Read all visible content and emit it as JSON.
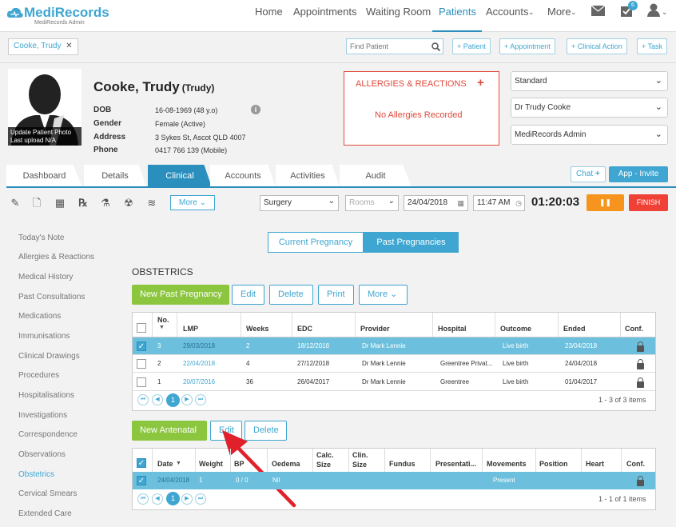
{
  "app": {
    "brand": "MediRecords",
    "brand_sub": "MediRecords Admin"
  },
  "nav": {
    "items": [
      "Home",
      "Appointments",
      "Waiting Room",
      "Patients",
      "Accounts",
      "More"
    ],
    "tasks_badge": "6"
  },
  "patient_bar": {
    "tab_name": "Cooke, Trudy",
    "find_placeholder": "Find Patient",
    "actions": [
      "+ Patient",
      "+ Appointment",
      "+ Clinical Action",
      "+ Task"
    ]
  },
  "patient": {
    "name": "Cooke, Trudy",
    "preferred": "(Trudy)",
    "photo_line1": "Update Patient Photo",
    "photo_line2": "Last upload N/A",
    "fields": [
      {
        "label": "DOB",
        "value": "16-08-1969 (48 y.o)"
      },
      {
        "label": "Gender",
        "value": "Female (Active)"
      },
      {
        "label": "Address",
        "value": "3 Sykes St, Ascot QLD 4007"
      },
      {
        "label": "Phone",
        "value": "0417 766 139 (Mobile)"
      }
    ]
  },
  "allergies": {
    "title": "ALLERGIES & REACTIONS",
    "plus": "+",
    "empty": "No Allergies Recorded"
  },
  "selects": [
    "Standard",
    "Dr Trudy Cooke",
    "MediRecords Admin"
  ],
  "tabs": [
    "Dashboard",
    "Details",
    "Clinical",
    "Accounts",
    "Activities",
    "Audit"
  ],
  "chat": {
    "label": "Chat",
    "plus": "+"
  },
  "app_invite": "App - Invite",
  "toolbar": {
    "more": "More",
    "location": "Surgery",
    "rooms": "Rooms",
    "date": "24/04/2018",
    "time": "11:47 AM",
    "timer": "01:20:03",
    "pause": "❚❚",
    "finish": "FINISH"
  },
  "sidebar": [
    "Today's Note",
    "Allergies & Reactions",
    "Medical History",
    "Past Consultations",
    "Medications",
    "Immunisations",
    "Clinical Drawings",
    "Procedures",
    "Hospitalisations",
    "Investigations",
    "Correspondence",
    "Observations",
    "Obstetrics",
    "Cervical Smears",
    "Extended Care"
  ],
  "toggle": {
    "current": "Current Pregnancy",
    "past": "Past Pregnancies"
  },
  "obstetrics": {
    "title": "OBSTETRICS",
    "buttons": {
      "new": "New Past Pregnancy",
      "edit": "Edit",
      "delete": "Delete",
      "print": "Print",
      "more": "More"
    },
    "headers": [
      "No.",
      "LMP",
      "Weeks",
      "EDC",
      "Provider",
      "Hospital",
      "Outcome",
      "Ended",
      "Conf."
    ],
    "rows": [
      {
        "no": "3",
        "lmp": "29/03/2018",
        "weeks": "2",
        "edc": "18/12/2018",
        "provider": "Dr Mark Lennie",
        "hospital": "",
        "outcome": "Live birth",
        "ended": "23/04/2018"
      },
      {
        "no": "2",
        "lmp": "22/04/2018",
        "weeks": "4",
        "edc": "27/12/2018",
        "provider": "Dr Mark Lennie",
        "hospital": "Greentree Privat...",
        "outcome": "Live birth",
        "ended": "24/04/2018"
      },
      {
        "no": "1",
        "lmp": "20/07/2016",
        "weeks": "36",
        "edc": "26/04/2017",
        "provider": "Dr Mark Lennie",
        "hospital": "Greentree",
        "outcome": "Live birth",
        "ended": "01/04/2017"
      }
    ],
    "page": "1",
    "count": "1 - 3 of 3 items"
  },
  "antenatal": {
    "buttons": {
      "new": "New Antenatal",
      "edit": "Edit",
      "delete": "Delete"
    },
    "headers": [
      "Date",
      "Weight",
      "BP",
      "Oedema",
      "Calc. Size",
      "Clin. Size",
      "Fundus",
      "Presentati...",
      "Movements",
      "Position",
      "Heart",
      "Conf."
    ],
    "rows": [
      {
        "date": "24/04/2018",
        "weight": "1",
        "bp": "0 / 0",
        "oedema": "Nil",
        "movements": "Present"
      }
    ],
    "page": "1",
    "count": "1 - 1 of 1 items"
  },
  "colors": {
    "brand": "#3ea6d1",
    "active_tab": "#2a8fbd",
    "green": "#8cc63f",
    "pause": "#f7941d",
    "finish": "#ef4136",
    "allergy": "#e04a3c",
    "arrow": "#e0202a"
  }
}
